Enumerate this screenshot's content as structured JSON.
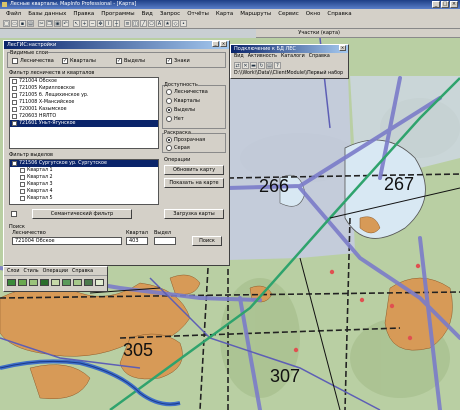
{
  "app": {
    "title": "Лесные кварталы. MapInfo Professional - [Карта]",
    "window_buttons": [
      "_",
      "□",
      "×"
    ]
  },
  "menubar": [
    "Файл",
    "Базы данных",
    "Правка",
    "Программы",
    "Вид",
    "Запрос",
    "Отчёты",
    "Карта",
    "Маршруты",
    "Сервис",
    "Окно",
    "Справка"
  ],
  "toolbar_icons": [
    "new-icon",
    "open-icon",
    "save-icon",
    "print-icon",
    "cut-icon",
    "copy-icon",
    "paste-icon",
    "undo-icon",
    "select-icon",
    "zoom-in-icon",
    "zoom-out-icon",
    "pan-icon",
    "info-icon",
    "ruler-icon",
    "legend-icon",
    "layers-icon",
    "draw-line-icon",
    "polygon-icon",
    "text-icon",
    "symbol-icon",
    "reshape-icon",
    "node-icon"
  ],
  "map_subtitle": "Участки (карта)",
  "map": {
    "quarters": [
      "266",
      "267",
      "305",
      "307"
    ],
    "colors": {
      "tundra": "#b8cfa0",
      "forest": "#c6e2bd",
      "lake": "#d8e8f3",
      "orange_area": "#d79a57",
      "road": "#7b7cc9",
      "pipeline": "#2fa36d",
      "river": "#3f6fc8",
      "selection": "#c6cbe4"
    }
  },
  "layers_dialog": {
    "title": "ЛесГИС:настройки",
    "visible_layers_label": "Видимые слои",
    "visible_layers": [
      {
        "label": "Лесничества",
        "checked": false
      },
      {
        "label": "Кварталы",
        "checked": true
      },
      {
        "label": "Выделы",
        "checked": true
      },
      {
        "label": "Знаки",
        "checked": true
      }
    ],
    "forestry_filter_label": "Фильтр лесничеств и кварталов",
    "forestry_list": [
      {
        "label": "721004 Обское",
        "checked": false,
        "selected": false
      },
      {
        "label": "721005 Кирилловское",
        "checked": false,
        "selected": false
      },
      {
        "label": "721005 б. Лещихинское ур.",
        "checked": false,
        "selected": false
      },
      {
        "label": "711008 Х-Мансийское",
        "checked": false,
        "selected": false
      },
      {
        "label": "720001 Казымское",
        "checked": false,
        "selected": false
      },
      {
        "label": "720603 НЯЛТО",
        "checked": false,
        "selected": false
      },
      {
        "label": "721601 Уньт-Ягунское",
        "checked": true,
        "selected": true
      }
    ],
    "access_label": "Доступность",
    "access_options": [
      {
        "label": "Лесничества",
        "on": false
      },
      {
        "label": "Кварталы",
        "on": false
      },
      {
        "label": "Выделы",
        "on": true
      },
      {
        "label": "Нет",
        "on": false
      }
    ],
    "coloring_label": "Раскраска",
    "coloring_options": [
      {
        "label": "Прозрачная",
        "on": true
      },
      {
        "label": "Серая",
        "on": false
      }
    ],
    "operations_label": "Операции",
    "buttons": {
      "refresh_map": "Обновить карту",
      "show_on_map": "Показать на карте",
      "load_map": "Загрузка карты",
      "semantic_filter": "Семантический фильтр",
      "search": "Поиск"
    },
    "plot_filter_label": "Фильтр выделов",
    "plot_tree": [
      {
        "label": "721506 Сургутское ур. Сургутское",
        "selected": true
      },
      {
        "label": "Квартал 1",
        "selected": false
      },
      {
        "label": "Квартал 2",
        "selected": false
      },
      {
        "label": "Квартал 3",
        "selected": false
      },
      {
        "label": "Квартал 4",
        "selected": false
      },
      {
        "label": "Квартал 5",
        "selected": false
      }
    ],
    "search_label": "Поиск",
    "forestry_field_label": "Лесничество",
    "forestry_value": "721004 Обское",
    "quarter_field_label": "Квартал",
    "quarter_value": "403",
    "plot_field_label": "Выдел",
    "plot_value": ""
  },
  "conn_dialog": {
    "title": "Подключение к БД ЛЕС",
    "menu": [
      "Вид",
      "Активность",
      "Каталоги",
      "Справка"
    ],
    "tool_icons": [
      "connect-icon",
      "disconnect-icon",
      "delete-icon",
      "refresh-icon",
      "props-icon",
      "help-icon"
    ],
    "path": "D:\\\\Work\\\\Data\\\\ClientModule\\\\Первый набор"
  },
  "styles_panel": {
    "menu": [
      "Слои",
      "Стиль",
      "Операции",
      "Справка"
    ],
    "swatches": [
      "#3b8a3a",
      "#6aa84f",
      "#9bc37a",
      "#2b6e2b",
      "#c7d9a8",
      "#5b9b5b",
      "#a7c98a",
      "#4c7a4c",
      "#e2ecd0"
    ]
  }
}
